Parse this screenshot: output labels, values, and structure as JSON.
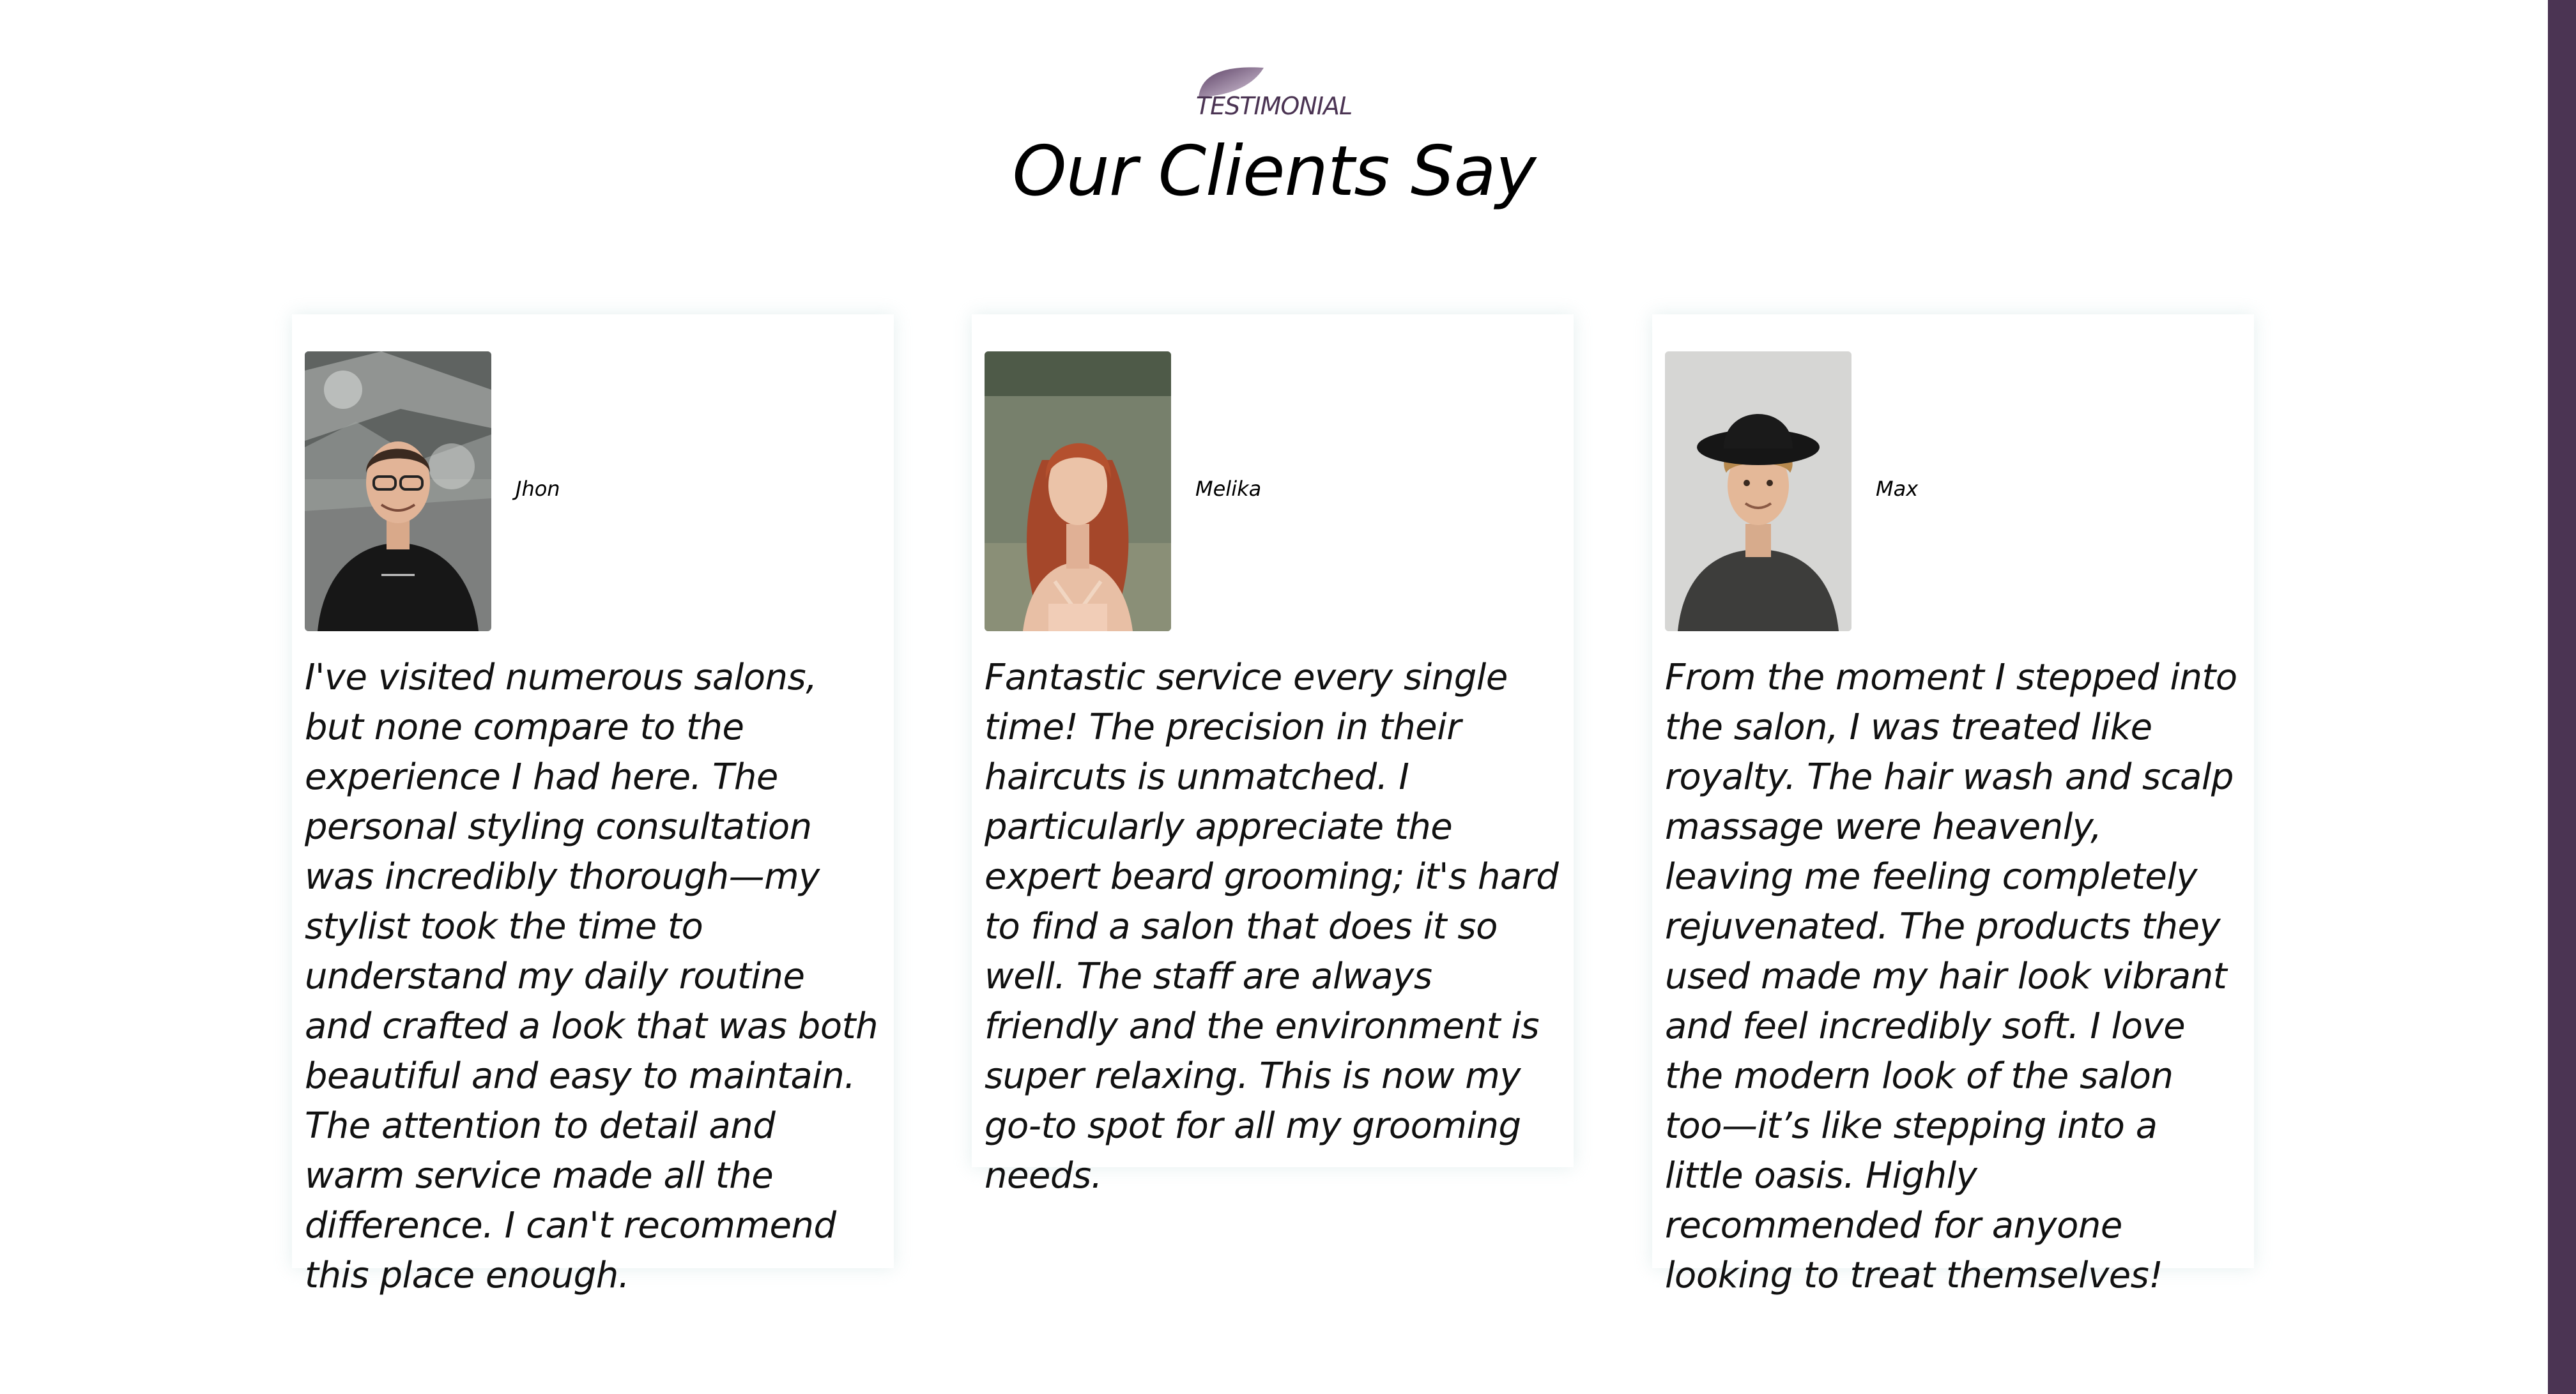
{
  "section": {
    "eyebrow": "TESTIMONIAL",
    "title": "Our Clients Say",
    "icon": "leaf-icon",
    "accent_color": "#4b3453"
  },
  "testimonials": [
    {
      "name": "Jhon",
      "avatar": "avatar-photo-man-glasses",
      "quote": "I've visited numerous salons, but none compare to the experience I had here. The personal styling consultation was incredibly thorough—my stylist took the time to understand my daily routine and crafted a look that was both beautiful and easy to maintain. The attention to detail and warm service made all the difference. I can't recommend this place enough."
    },
    {
      "name": "Melika",
      "avatar": "avatar-photo-woman-red-hair",
      "quote": "Fantastic service every single time! The precision in their haircuts is unmatched. I particularly appreciate the expert beard grooming; it's hard to find a salon that does it so well. The staff are always friendly and the environment is super relaxing. This is now my go-to spot for all my grooming needs."
    },
    {
      "name": "Max",
      "avatar": "avatar-photo-man-hat",
      "quote": "From the moment I stepped into the salon, I was treated like royalty. The hair wash and scalp massage were heavenly, leaving me feeling completely rejuvenated. The products they used made my hair look vibrant and feel incredibly soft. I love the modern look of the salon too—it’s like stepping into a little oasis. Highly recommended for anyone looking to treat themselves!"
    }
  ]
}
